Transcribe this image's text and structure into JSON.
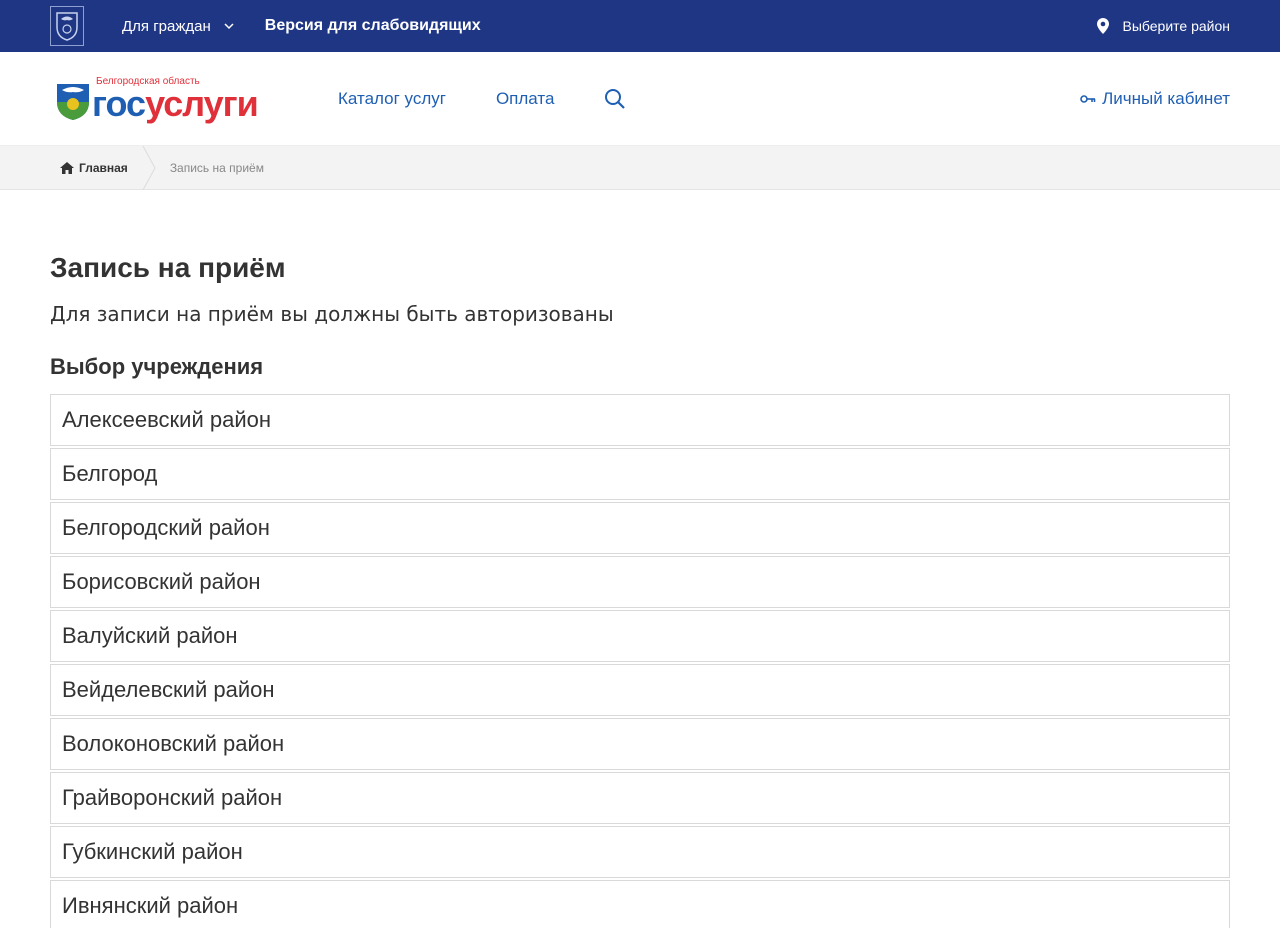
{
  "topbar": {
    "for_citizens": "Для граждан",
    "low_vision": "Версия для слабовидящих",
    "region": "Выберите район"
  },
  "header": {
    "logo_region": "Белгородская область",
    "logo_gos": "гос",
    "logo_uslugi": "услуги",
    "nav": {
      "catalog": "Каталог услуг",
      "payment": "Оплата"
    },
    "cabinet": "Личный кабинет"
  },
  "breadcrumb": {
    "home": "Главная",
    "current": "Запись на приём"
  },
  "main": {
    "title": "Запись на приём",
    "subtitle": "Для записи на приём вы должны быть авторизованы",
    "section_title": "Выбор учреждения",
    "institutions": [
      "Алексеевский район",
      "Белгород",
      "Белгородский район",
      "Борисовский район",
      "Валуйский район",
      "Вейделевский район",
      "Волоконовский район",
      "Грайворонский район",
      "Губкинский район",
      "Ивнянский район"
    ]
  },
  "colors": {
    "topbar_bg": "#1f3685",
    "link_blue": "#1f5fb3",
    "brand_red": "#e0303a"
  },
  "icons": [
    "emblem-icon",
    "chevron-down-icon",
    "location-pin-icon",
    "search-icon",
    "key-icon",
    "home-icon"
  ]
}
